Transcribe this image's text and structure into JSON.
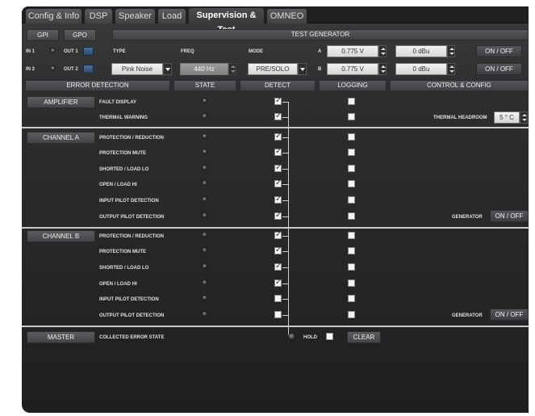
{
  "tabs": [
    "Config & Info",
    "DSP",
    "Speaker",
    "Load",
    "Supervision & Test",
    "OMNEO"
  ],
  "active_tab": "Supervision & Test",
  "io": {
    "gpi": "GPI",
    "gpo": "GPO",
    "in1": "IN 1",
    "out1": "OUT 1",
    "in2": "IN 2",
    "out2": "OUT 2"
  },
  "generator": {
    "header": "TEST GENERATOR",
    "type_label": "TYPE",
    "type_value": "Pink Noise",
    "freq_label": "FREQ",
    "freq_value": "440 Hz",
    "mode_label": "MODE",
    "mode_value": "PRE/SOLO",
    "a_label": "A",
    "a_voltage": "0.775 V",
    "a_level": "0 dBu",
    "a_onoff": "ON / OFF",
    "b_label": "B",
    "b_voltage": "0.775 V",
    "b_level": "0 dBu",
    "b_onoff": "ON / OFF"
  },
  "columns": {
    "error_detection": "ERROR DETECTION",
    "state": "STATE",
    "detect": "DETECT",
    "logging": "LOGGING",
    "control": "CONTROL & CONFIG"
  },
  "groups": [
    {
      "name": "AMPLIFIER",
      "rows": [
        {
          "label": "FAULT DISPLAY",
          "detect": true,
          "logging": false
        },
        {
          "label": "THERMAL WARNING",
          "detect": true,
          "logging": false
        }
      ],
      "control_label": "THERMAL HEADROOM",
      "control_value": "5 ° C"
    },
    {
      "name": "CHANNEL A",
      "rows": [
        {
          "label": "PROTECTION / REDUCTION",
          "detect": true,
          "logging": false
        },
        {
          "label": "PROTECTION MUTE",
          "detect": true,
          "logging": false
        },
        {
          "label": "SHORTED / LOAD LO",
          "detect": true,
          "logging": false
        },
        {
          "label": "OPEN / LOAD HI",
          "detect": true,
          "logging": false
        },
        {
          "label": "INPUT PILOT DETECTION",
          "detect": true,
          "logging": false
        },
        {
          "label": "OUTPUT PILOT DETECTION",
          "detect": true,
          "logging": false
        }
      ],
      "control_label": "GENERATOR",
      "control_value": "ON / OFF"
    },
    {
      "name": "CHANNEL B",
      "rows": [
        {
          "label": "PROTECTION / REDUCTION",
          "detect": true,
          "logging": false
        },
        {
          "label": "PROTECTION MUTE",
          "detect": true,
          "logging": false
        },
        {
          "label": "SHORTED / LOAD LO",
          "detect": true,
          "logging": false
        },
        {
          "label": "OPEN / LOAD HI",
          "detect": true,
          "logging": false
        },
        {
          "label": "INPUT PILOT DETECTION",
          "detect": false,
          "logging": false
        },
        {
          "label": "OUTPUT PILOT DETECTION",
          "detect": false,
          "logging": false
        }
      ],
      "control_label": "GENERATOR",
      "control_value": "ON / OFF"
    }
  ],
  "master": {
    "name": "MASTER",
    "label": "COLLECTED ERROR STATE",
    "hold": "HOLD",
    "clear": "CLEAR"
  },
  "colors": {
    "panel": "#2c2d2f",
    "button": "#4a4b4e",
    "accent_blue": "#3a5c86",
    "separator": "#c9c9c9"
  }
}
